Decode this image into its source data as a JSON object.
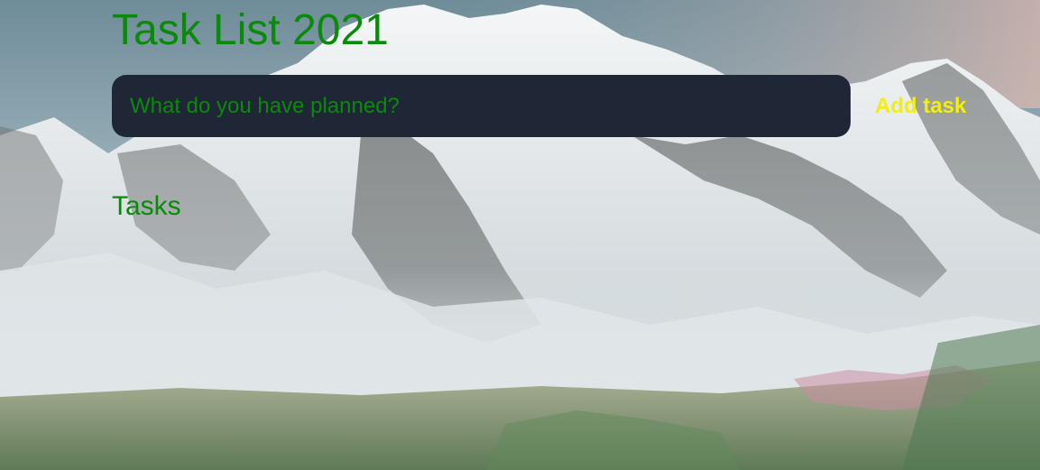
{
  "header": {
    "title": "Task List 2021"
  },
  "form": {
    "input_placeholder": "What do you have planned?",
    "input_value": "",
    "add_button_label": "Add task"
  },
  "tasks_section": {
    "heading": "Tasks",
    "items": []
  },
  "colors": {
    "text_green": "#0a8a0a",
    "button_yellow": "#f2ee12",
    "input_background": "#1f2737"
  },
  "background": {
    "description_icon": "mountain-landscape-image"
  }
}
